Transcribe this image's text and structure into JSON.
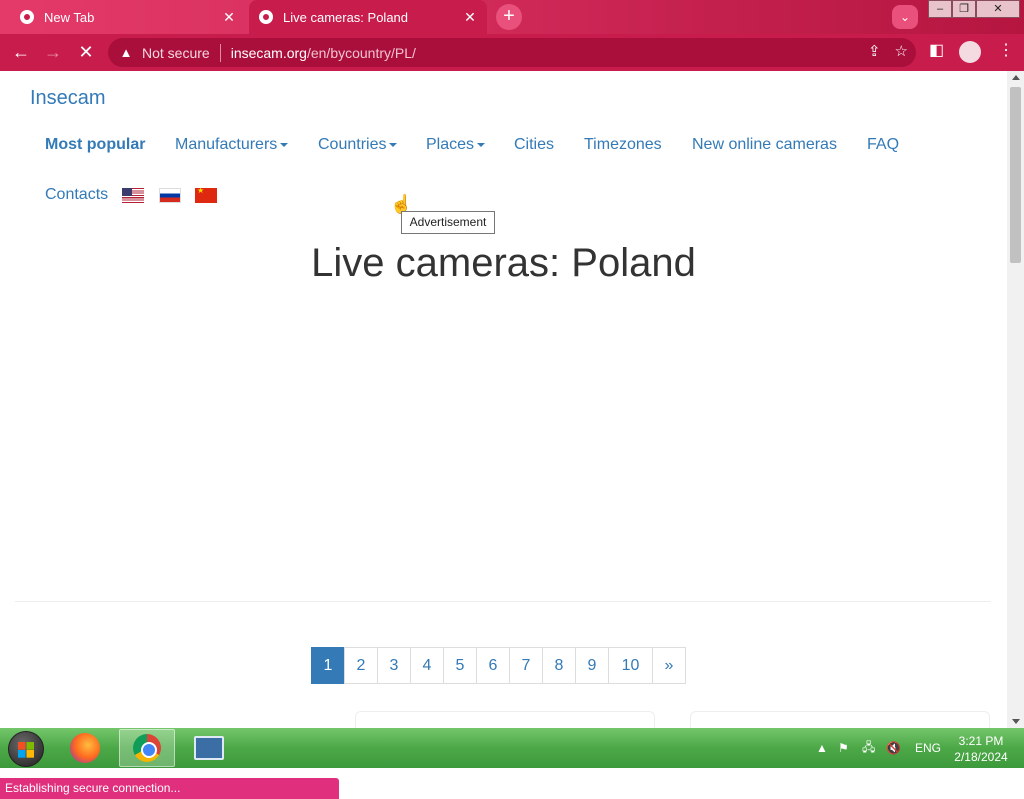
{
  "browser": {
    "tabs": [
      {
        "title": "New Tab"
      },
      {
        "title": "Live cameras: Poland"
      }
    ],
    "close_glyph": "✕",
    "new_tab_glyph": "+",
    "security_label": "Not secure",
    "url_host": "insecam.org",
    "url_path": "/en/bycountry/PL/",
    "status_text": "Establishing secure connection..."
  },
  "site": {
    "brand": "Insecam",
    "nav": {
      "most_popular": "Most popular",
      "manufacturers": "Manufacturers",
      "countries": "Countries",
      "places": "Places",
      "cities": "Cities",
      "timezones": "Timezones",
      "new_online_cameras": "New online cameras",
      "faq": "FAQ",
      "contacts": "Contacts"
    },
    "tooltip": "Advertisement",
    "heading": "Live cameras: Poland",
    "pagination": {
      "pages": [
        "1",
        "2",
        "3",
        "4",
        "5",
        "6",
        "7",
        "8",
        "9",
        "10"
      ],
      "next": "»",
      "current": "1"
    }
  },
  "taskbar": {
    "language": "ENG",
    "time": "3:21 PM",
    "date": "2/18/2024"
  },
  "colors": {
    "browser_theme": "#c81d4c",
    "link": "#337ab7",
    "status_bar": "#e0307d",
    "taskbar": "#4ca847"
  }
}
